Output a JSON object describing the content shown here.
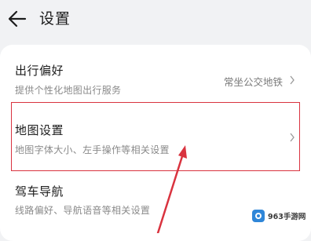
{
  "header": {
    "title": "设置"
  },
  "settings": {
    "items": [
      {
        "title": "出行偏好",
        "subtitle": "提供个性化地图出行服务",
        "value": "常坐公交地铁"
      },
      {
        "title": "地图设置",
        "subtitle": "地图字体大小、左手操作等相关设置"
      },
      {
        "title": "驾车导航",
        "subtitle": "线路偏好、导航语音等相关设置"
      }
    ]
  },
  "watermark": {
    "text": "963手游网"
  },
  "colors": {
    "annotation": "#d9333f",
    "background": "#f1f2f4",
    "card": "#ffffff"
  }
}
